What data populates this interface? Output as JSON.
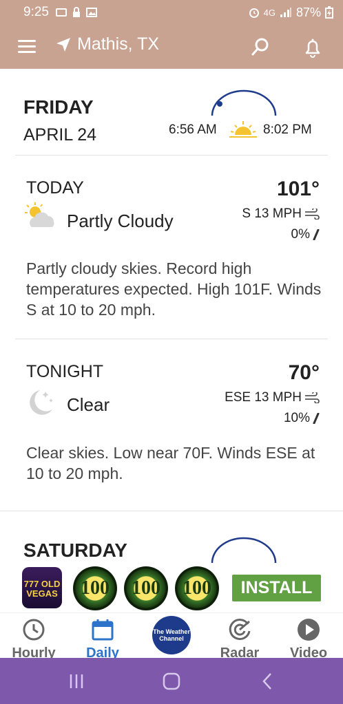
{
  "status": {
    "time": "9:25",
    "network": "4G",
    "battery": "87%"
  },
  "header": {
    "location": "Mathis, TX"
  },
  "day": {
    "name": "FRIDAY",
    "date": "APRIL 24",
    "sunrise": "6:56 AM",
    "sunset": "8:02 PM"
  },
  "today": {
    "label": "TODAY",
    "temp": "101°",
    "condition": "Partly Cloudy",
    "wind": "S 13 MPH",
    "precip": "0%",
    "description": "Partly cloudy skies. Record high temperatures expected. High 101F. Winds S at 10 to 20 mph."
  },
  "tonight": {
    "label": "TONIGHT",
    "temp": "70°",
    "condition": "Clear",
    "wind": "ESE 13 MPH",
    "precip": "10%",
    "description": "Clear skies. Low near 70F. Winds ESE at 10 to 20 mph."
  },
  "next_day": {
    "name": "SATURDAY"
  },
  "ad": {
    "logo_text": "777 OLD VEGAS",
    "coin_value": "100",
    "install_label": "INSTALL"
  },
  "nav": {
    "hourly": "Hourly",
    "daily": "Daily",
    "brand": "The Weather Channel",
    "radar": "Radar",
    "video": "Video"
  },
  "colors": {
    "header": "#c9a392",
    "accent": "#2d73c9",
    "install": "#62a044",
    "system_nav": "#7e58ab"
  }
}
